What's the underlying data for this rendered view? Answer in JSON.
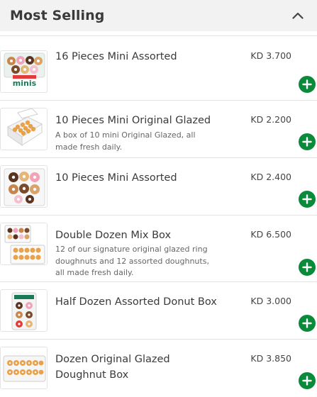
{
  "section": {
    "title": "Most Selling"
  },
  "currency": "KD",
  "colors": {
    "accent": "#0a8a3a",
    "header_bg": "#f2f2f2"
  },
  "icons": {
    "collapse": "chevron-up-icon",
    "add": "plus-icon"
  },
  "products": [
    {
      "name": "16 Pieces Mini Assorted",
      "description": "",
      "price": "KD 3.700",
      "thumb_text": "minis"
    },
    {
      "name": "10 Pieces Mini Original Glazed",
      "description": "A box of 10 mini Original Glazed, all made fresh daily.",
      "price": "KD 2.200"
    },
    {
      "name": "10 Pieces Mini Assorted",
      "description": "",
      "price": "KD 2.400"
    },
    {
      "name": "Double Dozen Mix Box",
      "description": "12 of our signature original glazed ring doughnuts and 12 assorted doughnuts, all made fresh daily.",
      "price": "KD 6.500"
    },
    {
      "name": "Half Dozen Assorted Donut Box",
      "description": "",
      "price": "KD 3.000"
    },
    {
      "name": "Dozen Original Glazed Doughnut Box",
      "description": "",
      "price": "KD 3.850"
    }
  ]
}
